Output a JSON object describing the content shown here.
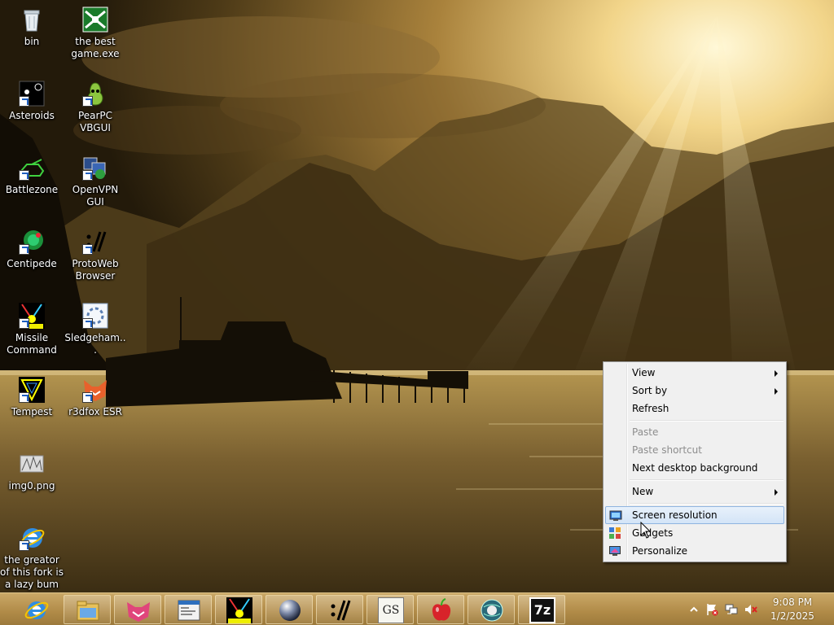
{
  "desktop": {
    "icons": [
      {
        "label": "bin",
        "icon": "recycle-bin-icon"
      },
      {
        "label": "the best game.exe",
        "icon": "game-exe-icon"
      },
      {
        "label": "Asteroids",
        "icon": "asteroids-icon"
      },
      {
        "label": "PearPC VBGUI",
        "icon": "pearpc-icon"
      },
      {
        "label": "Battlezone",
        "icon": "battlezone-icon"
      },
      {
        "label": "OpenVPN GUI",
        "icon": "openvpn-icon"
      },
      {
        "label": "Centipede",
        "icon": "centipede-icon"
      },
      {
        "label": "ProtoWeb Browser",
        "icon": "protoweb-icon"
      },
      {
        "label": "Missile Command",
        "icon": "missile-command-icon"
      },
      {
        "label": "Sledgeham...",
        "icon": "sledgehammer-icon"
      },
      {
        "label": "Tempest",
        "icon": "tempest-icon"
      },
      {
        "label": "r3dfox ESR",
        "icon": "r3dfox-icon"
      },
      {
        "label": "img0.png",
        "icon": "image-file-icon"
      },
      {
        "label": "the greator of this fork is a lazy bum",
        "icon": "internet-explorer-icon"
      }
    ]
  },
  "context_menu": {
    "items": {
      "view": "View",
      "sort_by": "Sort by",
      "refresh": "Refresh",
      "paste": "Paste",
      "paste_shortcut": "Paste shortcut",
      "next_background": "Next desktop background",
      "new": "New",
      "screen_resolution": "Screen resolution",
      "gadgets": "Gadgets",
      "personalize": "Personalize"
    },
    "highlighted": "Screen resolution"
  },
  "taskbar": {
    "pinned": [
      "internet-explorer-icon",
      "file-explorer-icon",
      "r3dfox-icon",
      "window-app-icon",
      "missile-command-icon",
      "sphere-app-icon",
      "protoweb-icon",
      "ghostscript-icon",
      "apple-icon",
      "globe-app-icon",
      "7zip-icon"
    ],
    "gs_label": "GS",
    "sevenzip_label": "7z",
    "tray": {
      "icons": [
        "show-hidden-icons-chevron",
        "action-center-flag-icon",
        "network-icon",
        "volume-muted-icon"
      ],
      "time": "9:08 PM",
      "date": "1/2/2025"
    }
  },
  "colors": {
    "menu_highlight": "#d3e4f7",
    "taskbar": "#b08a47"
  }
}
